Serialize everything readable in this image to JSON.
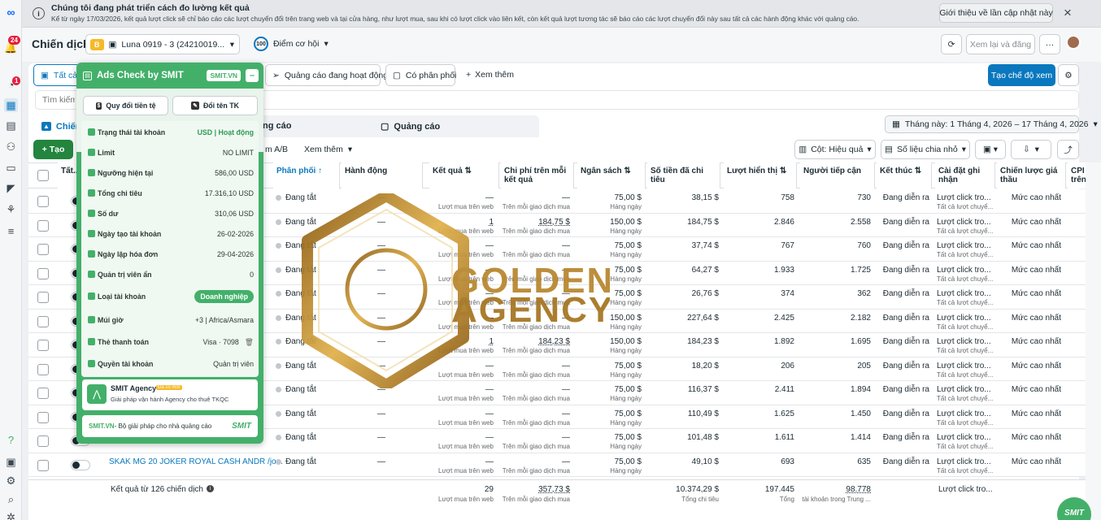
{
  "banner": {
    "title": "Chúng tôi đang phát triển cách đo lường kết quả",
    "body": "Kể từ ngày 17/03/2026, kết quả lượt click sẽ chỉ báo cáo các lượt chuyển đổi trên trang web và tại cửa hàng, như lượt mua, sau khi có lượt click vào liên kết, còn kết quả lượt tương tác sẽ báo cáo các lượt chuyển đổi này sau tất cả các hành động khác với quảng cáo.",
    "button": "Giới thiệu về lần cập nhật này",
    "close": "×"
  },
  "leftbar": {
    "notif_count": "24",
    "chat_count": "1"
  },
  "header": {
    "title": "Chiến dịch",
    "account_badge": "B",
    "account": "Luna 0919 - 3 (24210019...",
    "score_badge": "100",
    "score_label": "Điểm cơ hội",
    "review_button": "Xem lại và đăng"
  },
  "tabs": {
    "all": "Tất cả",
    "active_ads": "Quảng cáo đang hoạt động",
    "has_delivery": "Có phân phối",
    "more": "Xem thêm",
    "create_view": "Tạo chế độ xem"
  },
  "search": {
    "placeholder": "Tìm kiếm"
  },
  "levels": {
    "campaigns": "Chiến",
    "adsets": "ng cáo",
    "ads": "Quảng cáo"
  },
  "date_range": "Tháng này: 1 Tháng 4, 2026 – 17 Tháng 4, 2026",
  "actions": {
    "create": "+ Tạo",
    "ab": "m A/B",
    "more": "Xem thêm",
    "columns": "Cột: Hiệu quả",
    "breakdown": "Số liệu chia nhỏ"
  },
  "columns": [
    "Tất...",
    "Phân phối ↑",
    "Hành động",
    "Kết quả ⇅",
    "Chi phí trên mỗi kết quả",
    "Ngân sách ⇅",
    "Số tiền đã chi tiêu",
    "Lượt hiển thị ⇅",
    "Người tiếp cận",
    "Kết thúc ⇅",
    "Cài đặt ghi nhận",
    "Chiến lược giá thầu",
    "CPI trên"
  ],
  "rows": [
    {
      "status": "Đang tắt",
      "action": "—",
      "result": "—",
      "result_sub": "Lượt mua trên web",
      "cpr": "—",
      "cpr_sub": "Trên mỗi giao dịch mua",
      "budget": "75,00 $",
      "spent": "38,15 $",
      "impr": "758",
      "reach": "730",
      "end": "Đang diễn ra",
      "attr": "Lượt click tro...",
      "bid": "Mức cao nhất"
    },
    {
      "status": "Đang tắt",
      "action": "—",
      "result": "1",
      "result_sub": "Lượt mua trên web",
      "cpr": "184,75 $",
      "cpr_sub": "Trên mỗi giao dịch mua",
      "budget": "150,00 $",
      "spent": "184,75 $",
      "impr": "2.846",
      "reach": "2.558",
      "end": "Đang diễn ra",
      "attr": "Lượt click tro...",
      "bid": "Mức cao nhất"
    },
    {
      "status": "Đang tắt",
      "action": "—",
      "result": "—",
      "result_sub": "Lượt mua trên web",
      "cpr": "—",
      "cpr_sub": "Trên mỗi giao dịch mua",
      "budget": "75,00 $",
      "spent": "37,74 $",
      "impr": "767",
      "reach": "760",
      "end": "Đang diễn ra",
      "attr": "Lượt click tro...",
      "bid": "Mức cao nhất"
    },
    {
      "status": "Đang tắt",
      "action": "—",
      "result": "—",
      "result_sub": "Lượt mua trên web",
      "cpr": "—",
      "cpr_sub": "Trên mỗi giao dịch mua",
      "budget": "75,00 $",
      "spent": "64,27 $",
      "impr": "1.933",
      "reach": "1.725",
      "end": "Đang diễn ra",
      "attr": "Lượt click tro...",
      "bid": "Mức cao nhất"
    },
    {
      "status": "Đang tắt",
      "action": "—",
      "result": "—",
      "result_sub": "Lượt mua trên web",
      "cpr": "—",
      "cpr_sub": "Trên mỗi giao dịch mua",
      "budget": "75,00 $",
      "spent": "26,76 $",
      "impr": "374",
      "reach": "362",
      "end": "Đang diễn ra",
      "attr": "Lượt click tro...",
      "bid": "Mức cao nhất"
    },
    {
      "status": "Đang tắt",
      "action": "—",
      "result": "—",
      "result_sub": "Lượt mua trên web",
      "cpr": "—",
      "cpr_sub": "Trên mỗi giao dịch mua",
      "budget": "150,00 $",
      "spent": "227,64 $",
      "impr": "2.425",
      "reach": "2.182",
      "end": "Đang diễn ra",
      "attr": "Lượt click tro...",
      "bid": "Mức cao nhất"
    },
    {
      "status": "Đang tắt",
      "action": "—",
      "result": "1",
      "result_sub": "Lượt mua trên web",
      "cpr": "184,23 $",
      "cpr_sub": "Trên mỗi giao dịch mua",
      "budget": "150,00 $",
      "spent": "184,23 $",
      "impr": "1.892",
      "reach": "1.695",
      "end": "Đang diễn ra",
      "attr": "Lượt click tro...",
      "bid": "Mức cao nhất"
    },
    {
      "status": "Đang tắt",
      "action": "—",
      "result": "—",
      "result_sub": "Lượt mua trên web",
      "cpr": "—",
      "cpr_sub": "Trên mỗi giao dịch mua",
      "budget": "75,00 $",
      "spent": "18,20 $",
      "impr": "206",
      "reach": "205",
      "end": "Đang diễn ra",
      "attr": "Lượt click tro...",
      "bid": "Mức cao nhất"
    },
    {
      "status": "Đang tắt",
      "action": "—",
      "result": "—",
      "result_sub": "Lượt mua trên web",
      "cpr": "—",
      "cpr_sub": "Trên mỗi giao dịch mua",
      "budget": "75,00 $",
      "spent": "116,37 $",
      "impr": "2.411",
      "reach": "1.894",
      "end": "Đang diễn ra",
      "attr": "Lượt click tro...",
      "bid": "Mức cao nhất"
    },
    {
      "status": "Đang tắt",
      "action": "—",
      "result": "—",
      "result_sub": "Lượt mua trên web",
      "cpr": "—",
      "cpr_sub": "Trên mỗi giao dịch mua",
      "budget": "75,00 $",
      "spent": "110,49 $",
      "impr": "1.625",
      "reach": "1.450",
      "end": "Đang diễn ra",
      "attr": "Lượt click tro...",
      "bid": "Mức cao nhất"
    },
    {
      "status": "Đang tắt",
      "action": "—",
      "result": "—",
      "result_sub": "Lượt mua trên web",
      "cpr": "—",
      "cpr_sub": "Trên mỗi giao dịch mua",
      "budget": "75,00 $",
      "spent": "101,48 $",
      "impr": "1.611",
      "reach": "1.414",
      "end": "Đang diễn ra",
      "attr": "Lượt click tro...",
      "bid": "Mức cao nhất"
    },
    {
      "name": "SKAK MG 20 JOKER ROYAL CASH ANDR /jo...",
      "status": "Đang tắt",
      "action": "—",
      "result": "—",
      "result_sub": "Lượt mua trên web",
      "cpr": "—",
      "cpr_sub": "Trên mỗi giao dịch mua",
      "budget": "75,00 $",
      "spent": "49,10 $",
      "impr": "693",
      "reach": "635",
      "end": "Đang diễn ra",
      "attr": "Lượt click tro...",
      "bid": "Mức cao nhất"
    }
  ],
  "row_common": {
    "budget_sub": "Hàng ngày",
    "attr_sub": "Tất cả lượt chuyể..."
  },
  "totals": {
    "label": "Kết quả từ 126 chiến dịch",
    "result": "29",
    "result_sub": "Lượt mua trên web",
    "cpr": "357,73 $",
    "cpr_sub": "Trên mỗi giao dịch mua",
    "spent": "10.374,29 $",
    "spent_sub": "Tổng chi tiêu",
    "impr": "197.445",
    "impr_sub": "Tổng",
    "reach": "98.778",
    "reach_sub": "tài khoản trong Trung ...",
    "attr": "Lượt click tro..."
  },
  "panel": {
    "title": "Ads Check by SMIT",
    "site_badge": "SMIT.VN",
    "btn_convert": "Quy đổi tiền tệ",
    "btn_rename": "Đổi tên TK",
    "fields": [
      {
        "label": "Trạng thái tài khoản",
        "value": "USD | Hoạt động"
      },
      {
        "label": "Limit",
        "value": "NO LIMIT"
      },
      {
        "label": "Ngưỡng hiện tại",
        "value": "586,00 USD"
      },
      {
        "label": "Tổng chi tiêu",
        "value": "17.316,10 USD"
      },
      {
        "label": "Số dư",
        "value": "310,06 USD"
      },
      {
        "label": "Ngày tạo tài khoản",
        "value": "26-02-2026"
      },
      {
        "label": "Ngày lập hóa đơn",
        "value": "29-04-2026"
      },
      {
        "label": "Quản trị viên ẩn",
        "value": "0"
      },
      {
        "label": "Loại tài khoản",
        "value": "Doanh nghiệp"
      },
      {
        "label": "Múi giờ",
        "value": "+3 | Africa/Asmara"
      },
      {
        "label": "Thẻ thanh toán",
        "value": "Visa · 7098"
      },
      {
        "label": "Quyền tài khoản",
        "value": "Quản trị viên"
      }
    ],
    "agency_name": "SMIT Agency",
    "agency_tag": "Đã có mới",
    "agency_desc": "Giải pháp vận hành Agency cho thuê TKQC",
    "footer_site": "SMIT.VN",
    "footer_text": " - Bộ giải pháp cho nhà quảng cáo",
    "footer_logo": "SMIT"
  },
  "watermark": {
    "line1": "GOLDEN",
    "line2": "AGENCY"
  },
  "fab": "SMIT",
  "colors": {
    "primary": "#0a78be",
    "smit_green": "#43b06a",
    "gold": "#b8862e"
  }
}
